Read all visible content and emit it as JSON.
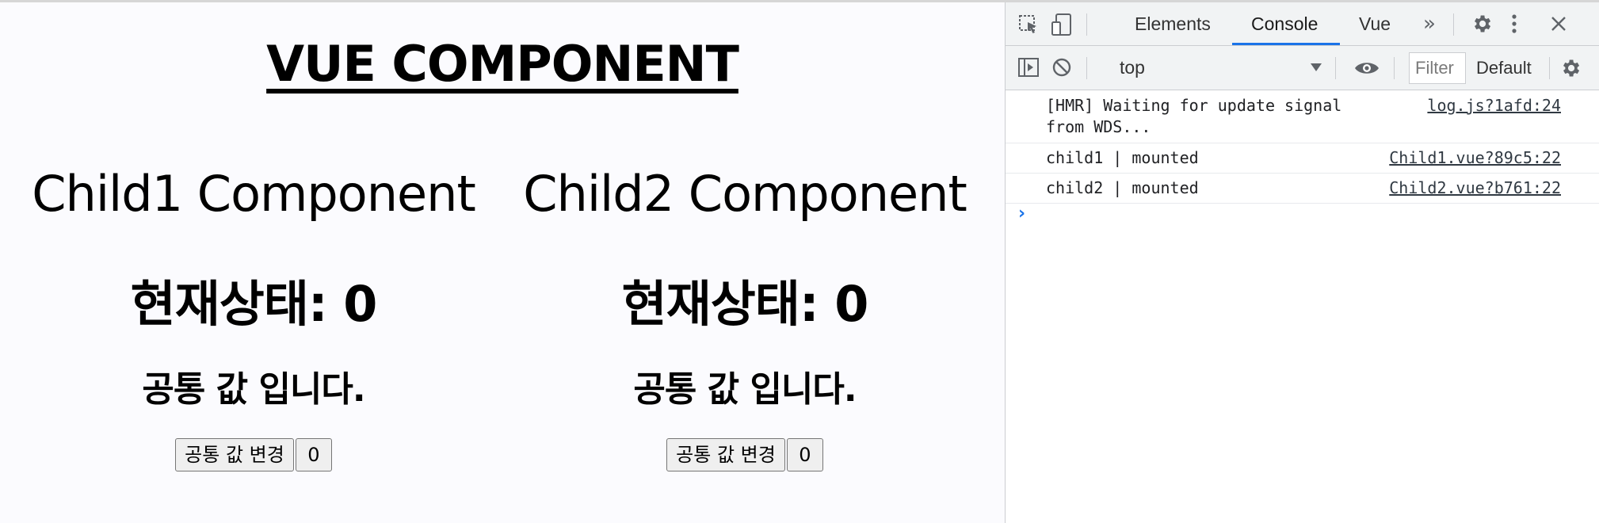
{
  "app": {
    "title": "VUE COMPONENT",
    "children": [
      {
        "title": "Child1 Component",
        "state_label": "현재상태: 0",
        "common_text": "공통 값 입니다.",
        "change_button": "공통 값 변경",
        "count_button": "0"
      },
      {
        "title": "Child2 Component",
        "state_label": "현재상태: 0",
        "common_text": "공통 값 입니다.",
        "change_button": "공통 값 변경",
        "count_button": "0"
      }
    ]
  },
  "devtools": {
    "tabs": [
      "Elements",
      "Console",
      "Vue"
    ],
    "active_tab": "Console",
    "more_tabs_icon": "chevron-double-right-icon",
    "context": "top",
    "filter_placeholder": "Filter",
    "levels": "Default levels",
    "accent_color": "#1a73e8",
    "logs": [
      {
        "message": "[HMR] Waiting for update signal\nfrom WDS...",
        "source": "log.js?1afd:24"
      },
      {
        "message": "child1 | mounted",
        "source": "Child1.vue?89c5:22"
      },
      {
        "message": "child2 | mounted",
        "source": "Child2.vue?b761:22"
      }
    ],
    "prompt_symbol": "›"
  }
}
